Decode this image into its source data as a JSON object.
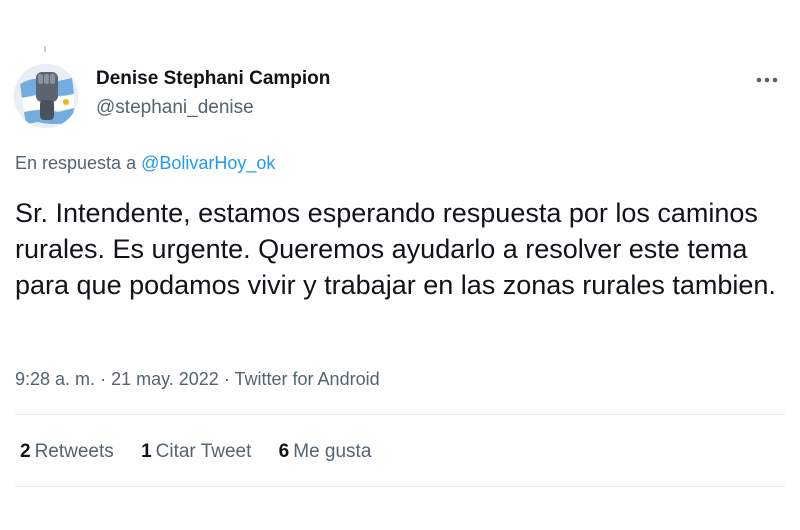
{
  "author": {
    "display_name": "Denise Stephani Campion",
    "handle": "@stephani_denise",
    "avatar_icon": "raised-fist-flag-avatar"
  },
  "reply": {
    "prefix": "En respuesta a",
    "mention": "@BolivarHoy_ok"
  },
  "tweet": {
    "text": "Sr. Intendente, estamos esperando respuesta por los caminos rurales. Es urgente. Queremos ayudarlo a resolver este tema para que podamos vivir y trabajar en las zonas rurales tambien."
  },
  "meta": {
    "time": "9:28 a. m.",
    "separator": "·",
    "date": "21 may. 2022",
    "source": "Twitter for Android"
  },
  "stats": {
    "retweets_count": "2",
    "retweets_label": "Retweets",
    "quotes_count": "1",
    "quotes_label": "Citar Tweet",
    "likes_count": "6",
    "likes_label": "Me gusta"
  },
  "icons": {
    "more": "more-horizontal-icon"
  },
  "colors": {
    "link": "#1d9bf0",
    "secondary_text": "#536471",
    "primary_text": "#0f1419",
    "divider": "#e3e8ec",
    "flag_blue": "#74acdf"
  }
}
